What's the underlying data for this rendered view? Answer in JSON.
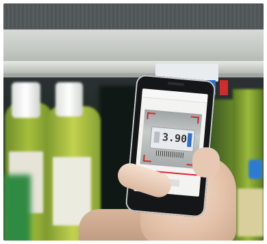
{
  "scene": {
    "description_tags": [
      "shelf",
      "bottles",
      "smartphone",
      "hand"
    ]
  },
  "phone": {
    "brand": "",
    "screen": {
      "price_readout": "3.90"
    }
  },
  "colors": {
    "bracket_red": "#d8262a",
    "tag_blue": "#2a6fd1",
    "bottle_green": "#a7bf3c"
  }
}
